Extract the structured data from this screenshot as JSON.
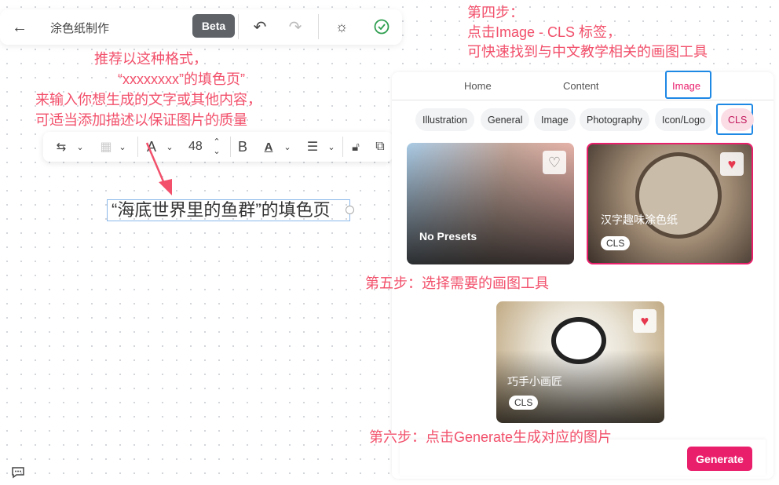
{
  "topbar": {
    "title": "涂色纸制作",
    "beta": "Beta"
  },
  "annotations": {
    "step_format": [
      "推荐以这种格式，",
      "“xxxxxxxx”的填色页”",
      "来输入你想生成的文字或其他内容，",
      "可适当添加描述以保证图片的质量"
    ],
    "step4": [
      "第四步：",
      "点击Image - CLS 标签，",
      "可快速找到与中文教学相关的画图工具"
    ],
    "step5": "第五步：选择需要的画图工具",
    "step6": "第六步：点击Generate生成对应的图片"
  },
  "toolbar": {
    "font_size": "48"
  },
  "canvas": {
    "text": "“海底世界里的鱼群”的填色页"
  },
  "panel": {
    "tabs": [
      {
        "label": "Home"
      },
      {
        "label": "Content"
      },
      {
        "label": "Image"
      }
    ],
    "active_tab": "Image",
    "chips": [
      {
        "label": "Illustration"
      },
      {
        "label": "General"
      },
      {
        "label": "Image"
      },
      {
        "label": "Photography"
      },
      {
        "label": "Icon/Logo"
      },
      {
        "label": "CLS"
      }
    ],
    "active_chip": "CLS",
    "cards": [
      {
        "name": "No Presets",
        "favorited": false
      },
      {
        "name": "汉字趣味涂色纸",
        "tag": "CLS",
        "favorited": true,
        "selected": true
      },
      {
        "name": "巧手小画匠",
        "tag": "CLS",
        "favorited": true
      }
    ],
    "generate": "Generate"
  },
  "colors": {
    "accent": "#ea1f6c",
    "annotation": "#f2506b",
    "highlight": "#1e88e5",
    "success": "#2e9e4f"
  }
}
